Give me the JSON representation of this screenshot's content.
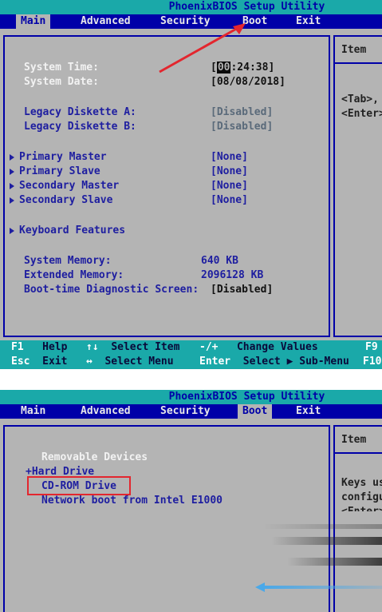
{
  "title": "PhoenixBIOS Setup Utility",
  "menu": [
    "Main",
    "Advanced",
    "Security",
    "Boot",
    "Exit"
  ],
  "screen1": {
    "active_tab": "Main",
    "side_title": "Item",
    "side_lines": [
      "<Tab>,",
      "<Enter>"
    ],
    "rows": [
      {
        "label": "System Time:",
        "value_prefix": "[",
        "value_cursor": "00",
        "value_rest": ":24:38]"
      },
      {
        "label": "System Date:",
        "value": "[08/08/2018]"
      },
      {
        "label": "Legacy Diskette A:",
        "value": "[Disabled]"
      },
      {
        "label": "Legacy Diskette B:",
        "value": "[Disabled]"
      },
      {
        "label": "Primary Master",
        "value": "[None]"
      },
      {
        "label": "Primary Slave",
        "value": "[None]"
      },
      {
        "label": "Secondary Master",
        "value": "[None]"
      },
      {
        "label": "Secondary Slave",
        "value": "[None]"
      },
      {
        "label": "Keyboard Features"
      },
      {
        "label": "System Memory:",
        "value": "640 KB"
      },
      {
        "label": "Extended Memory:",
        "value": "2096128 KB"
      },
      {
        "label": "Boot-time Diagnostic Screen:",
        "value": "[Disabled]"
      }
    ],
    "footer": {
      "row1": [
        {
          "key": "F1",
          "desc": "Help"
        },
        {
          "key": "↑↓",
          "desc": "Select Item"
        },
        {
          "key": "-/+",
          "desc": "Change Values"
        },
        {
          "key": "F9",
          "desc": ""
        }
      ],
      "row2": [
        {
          "key": "Esc",
          "desc": "Exit"
        },
        {
          "key": "↔",
          "desc": "Select Menu"
        },
        {
          "key": "Enter",
          "desc": "Select ▶ Sub-Menu"
        },
        {
          "key": "F10",
          "desc": ""
        }
      ]
    }
  },
  "screen2": {
    "active_tab": "Boot",
    "side_title": "Item",
    "side_lines": [
      "Keys us",
      "configu",
      "<Enter>"
    ],
    "items": [
      "Removable Devices",
      "+Hard Drive",
      "CD-ROM Drive",
      "Network boot from Intel E1000"
    ]
  },
  "colors": {
    "title_bar": "#1aa9a9",
    "menu_bar": "#0000a8",
    "background": "#b4b4b4",
    "highlight_annotation": "#e3262e",
    "pointer_arrow": "#4aa8e8"
  }
}
